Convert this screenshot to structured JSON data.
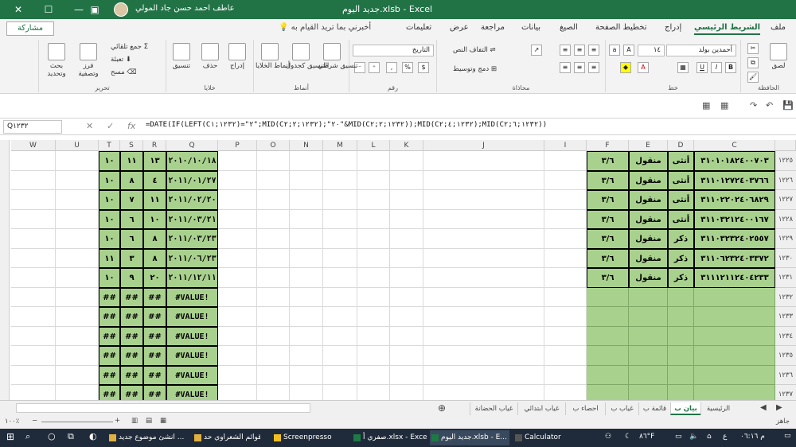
{
  "titlebar": {
    "app_title": "جديد اليوم.xlsb - Excel",
    "user": "عاطف احمد حسن جاد المولي"
  },
  "tabs": [
    "ملف",
    "الشريط الرئيسي",
    "إدراج",
    "تخطيط الصفحة",
    "الصيغ",
    "بيانات",
    "مراجعة",
    "عرض",
    "تعليمات"
  ],
  "tell_me": "أخبرني بما تريد القيام به",
  "share": "مشاركة",
  "ribbon": {
    "clipboard": {
      "label": "الحافظة",
      "paste": "لصق"
    },
    "font": {
      "label": "خط",
      "name": "أحمدين بولد",
      "size": "١٤",
      "bold": "B",
      "italic": "I",
      "underline": "U"
    },
    "align": {
      "label": "محاذاة",
      "wrap": "التفاف النص",
      "merge": "دمج وتوسيط"
    },
    "number": {
      "label": "رقم",
      "format": "التاريخ"
    },
    "styles": {
      "label": "أنماط",
      "cond": "تنسيق شرطي",
      "table": "التنسيق كجدول",
      "cell": "أنماط الخلايا"
    },
    "cells": {
      "label": "خلايا",
      "insert": "إدراج",
      "delete": "حذف",
      "format": "تنسيق"
    },
    "editing": {
      "label": "تحرير",
      "autosum": "جمع تلقائي",
      "fill": "تعبئة",
      "clear": "مسح",
      "sort": "فرز وتصفية",
      "find": "بحث وتحديد"
    }
  },
  "formula_bar": {
    "name_box": "Q١٢٣٢",
    "formula": "=DATE(IF(LEFT(C١٢٣٢;١)=\"٢\";MID(C١٢٣٢;٢;٢);\"٢٠\"&MID(C١٢٣٢;٢;٢));MID(C١٢٣٢;٤;٢);MID(C١٢٣٢;٦;٢))"
  },
  "columns": [
    "W",
    "U",
    "T",
    "S",
    "R",
    "Q",
    "P",
    "O",
    "N",
    "M",
    "L",
    "K",
    "J",
    "I",
    "F",
    "E",
    "D",
    "C"
  ],
  "row_numbers": [
    "١٢٢٥",
    "١٢٢٦",
    "١٢٢٧",
    "١٢٢٨",
    "١٢٢٩",
    "١٢٣٠",
    "١٢٣١",
    "١٢٣٢",
    "١٢٣٣",
    "١٢٣٤",
    "١٢٣٥",
    "١٢٣٦",
    "١٢٣٧"
  ],
  "rows": [
    {
      "T": "١٠",
      "S": "١١",
      "R": "١٣",
      "Q": "٢٠١٠/١٠/١٨",
      "F": "٣/٦",
      "E": "منقول",
      "D": "أنثى",
      "C": "٣١٠١٠١٨٢٤٠٠٧٠٣"
    },
    {
      "T": "١٠",
      "S": "٨",
      "R": "٤",
      "Q": "٢٠١١/٠١/٢٧",
      "F": "٣/٦",
      "E": "منقول",
      "D": "أنثى",
      "C": "٣١١٠١٢٧٢٤٠٣٧٦٦"
    },
    {
      "T": "١٠",
      "S": "٧",
      "R": "١١",
      "Q": "٢٠١١/٠٢/٢٠",
      "F": "٣/٦",
      "E": "منقول",
      "D": "أنثى",
      "C": "٣١١٠٢٢٠٢٤٠٦٨٢٩"
    },
    {
      "T": "١٠",
      "S": "٦",
      "R": "١٠",
      "Q": "٢٠١١/٠٣/٢١",
      "F": "٣/٦",
      "E": "منقول",
      "D": "أنثى",
      "C": "٣١١٠٣٢١٢٤٠٠١٦٧"
    },
    {
      "T": "١٠",
      "S": "٦",
      "R": "٨",
      "Q": "٢٠١١/٠٣/٢٣",
      "F": "٣/٦",
      "E": "منقول",
      "D": "ذكر",
      "C": "٣١١٠٣٢٣٢٤٠٢٥٥٧"
    },
    {
      "T": "١١",
      "S": "٣",
      "R": "٨",
      "Q": "٢٠١١/٠٦/٢٣",
      "F": "٣/٦",
      "E": "منقول",
      "D": "ذكر",
      "C": "٣١١٠٦٢٣٢٤٠٣٣٧٢"
    },
    {
      "T": "١٠",
      "S": "٩",
      "R": "٢٠",
      "Q": "٢٠١١/١٢/١١",
      "F": "٣/٦",
      "E": "منقول",
      "D": "ذكر",
      "C": "٣١١١٢١١٢٤٠٤٢٣٣"
    },
    {
      "T": "##",
      "S": "##",
      "R": "##",
      "Q": "#VALUE!",
      "F": "",
      "E": "",
      "D": "",
      "C": ""
    },
    {
      "T": "##",
      "S": "##",
      "R": "##",
      "Q": "#VALUE!",
      "F": "",
      "E": "",
      "D": "",
      "C": ""
    },
    {
      "T": "##",
      "S": "##",
      "R": "##",
      "Q": "#VALUE!",
      "F": "",
      "E": "",
      "D": "",
      "C": ""
    },
    {
      "T": "##",
      "S": "##",
      "R": "##",
      "Q": "#VALUE!",
      "F": "",
      "E": "",
      "D": "",
      "C": ""
    },
    {
      "T": "##",
      "S": "##",
      "R": "##",
      "Q": "#VALUE!",
      "F": "",
      "E": "",
      "D": "",
      "C": ""
    },
    {
      "T": "##",
      "S": "##",
      "R": "##",
      "Q": "#VALUE!",
      "F": "",
      "E": "",
      "D": "",
      "C": ""
    }
  ],
  "sheet_tabs": [
    "الرئيسية",
    "بيان ب",
    "قائمة ب",
    "غياب ب",
    "احصاء ب",
    "غياب ابتدائي",
    "غياب الحضانة"
  ],
  "active_sheet": "بيان ب",
  "status": {
    "ready": "جاهز",
    "zoom": "١٠٠٪"
  },
  "taskbar": {
    "items": [
      "انشئ موضوع جديد ...",
      "قوائم الشعراوي حد...",
      "Screenpresso",
      "صفري أ.xlsx - Excel",
      "جديد اليوم.xlsb - E...",
      "Calculator"
    ],
    "clock": "م ٠٦:١٦",
    "temp": "٨٦°F"
  },
  "colors": {
    "excel_green": "#217346",
    "cell_green": "#a9d18e"
  }
}
